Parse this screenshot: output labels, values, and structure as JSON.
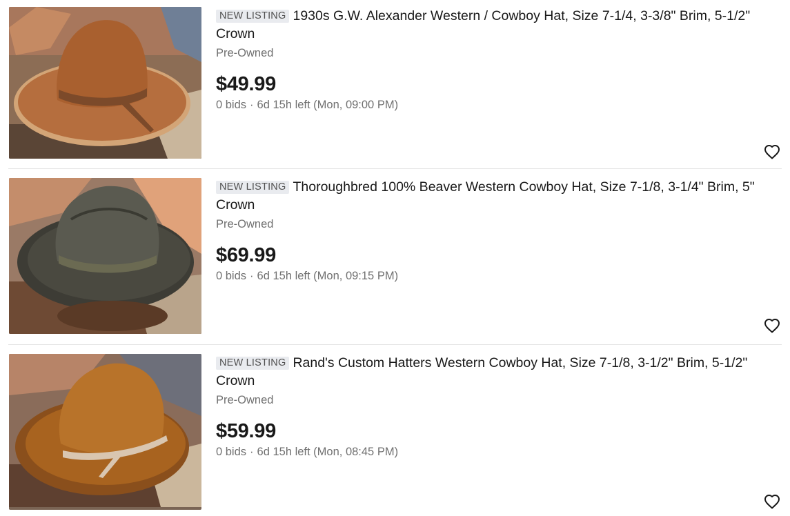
{
  "listings": [
    {
      "badge": "NEW LISTING",
      "title": "1930s G.W. Alexander Western / Cowboy Hat, Size 7-1/4, 3-3/8\" Brim, 5-1/2\" Crown",
      "condition": "Pre-Owned",
      "price": "$49.99",
      "bids": "0 bids",
      "separator": "·",
      "time_left": "6d 15h left (Mon, 09:00 PM)",
      "image_alt": "brown wide-brim cowboy hat photo",
      "watch_icon": "heart-icon"
    },
    {
      "badge": "NEW LISTING",
      "title": "Thoroughbred 100% Beaver Western Cowboy Hat, Size 7-1/8, 3-1/4\" Brim, 5\" Crown",
      "condition": "Pre-Owned",
      "price": "$69.99",
      "bids": "0 bids",
      "separator": "·",
      "time_left": "6d 15h left (Mon, 09:15 PM)",
      "image_alt": "gray beaver cowboy hat photo",
      "watch_icon": "heart-icon"
    },
    {
      "badge": "NEW LISTING",
      "title": "Rand's Custom Hatters Western Cowboy Hat, Size 7-1/8, 3-1/2\" Brim, 5-1/2\" Crown",
      "condition": "Pre-Owned",
      "price": "$59.99",
      "bids": "0 bids",
      "separator": "·",
      "time_left": "6d 15h left (Mon, 08:45 PM)",
      "image_alt": "tan cowboy hat photo",
      "watch_icon": "heart-icon"
    }
  ]
}
